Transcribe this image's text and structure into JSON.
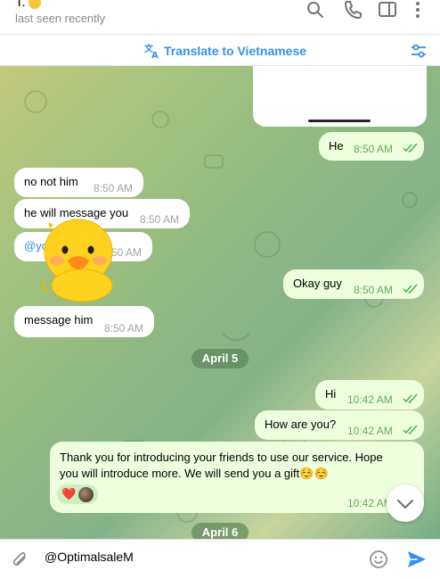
{
  "header": {
    "title": "T.",
    "title_emoji": "sun-face-emoji",
    "status": "last seen recently",
    "icons": [
      "search-icon",
      "phone-icon",
      "sidebar-toggle-icon",
      "more-vertical-icon"
    ]
  },
  "translate_bar": {
    "label": "Translate to Vietnamese",
    "icon": "translate-icon",
    "settings_icon": "sliders-icon"
  },
  "messages": [
    {
      "id": "m1",
      "dir": "out",
      "text": "He",
      "time": "8:50 AM",
      "read": true
    },
    {
      "id": "m2",
      "dir": "in",
      "text": "no not him",
      "time": "8:50 AM"
    },
    {
      "id": "m3",
      "dir": "in",
      "text": "he will message you",
      "time": "8:50 AM"
    },
    {
      "id": "m4",
      "dir": "in",
      "text": "@yo",
      "time": "8:50 AM"
    },
    {
      "id": "m5",
      "dir": "out",
      "text": "Okay guy",
      "time": "8:50 AM",
      "read": true
    },
    {
      "id": "m6",
      "dir": "in",
      "text": "message him",
      "time": "8:50 AM"
    },
    {
      "id": "m7",
      "dir": "out",
      "text": "Hi",
      "time": "10:42 AM",
      "read": true
    },
    {
      "id": "m8",
      "dir": "out",
      "text": "How are you?",
      "time": "10:42 AM",
      "read": true
    },
    {
      "id": "m9",
      "dir": "out",
      "text_line1": "Thank you for introducing your friends to use our service. Hope",
      "text_line2": "you will introduce more. We will send you a gift☺️☺️",
      "time": "10:42 AM",
      "reactions": [
        "❤️",
        "avatar"
      ]
    }
  ],
  "sticker": "duck-sticker",
  "date_separators": [
    "April 5",
    "April 6"
  ],
  "composer": {
    "value": "@OptimalsaleM",
    "attach_icon": "paperclip-icon",
    "emoji_icon": "smiley-icon",
    "send_icon": "send-icon"
  },
  "colors": {
    "accent": "#3390ec",
    "outgoing_bubble": "#eeffde",
    "incoming_bubble": "#ffffff",
    "read_ticks": "#4fae4e"
  }
}
